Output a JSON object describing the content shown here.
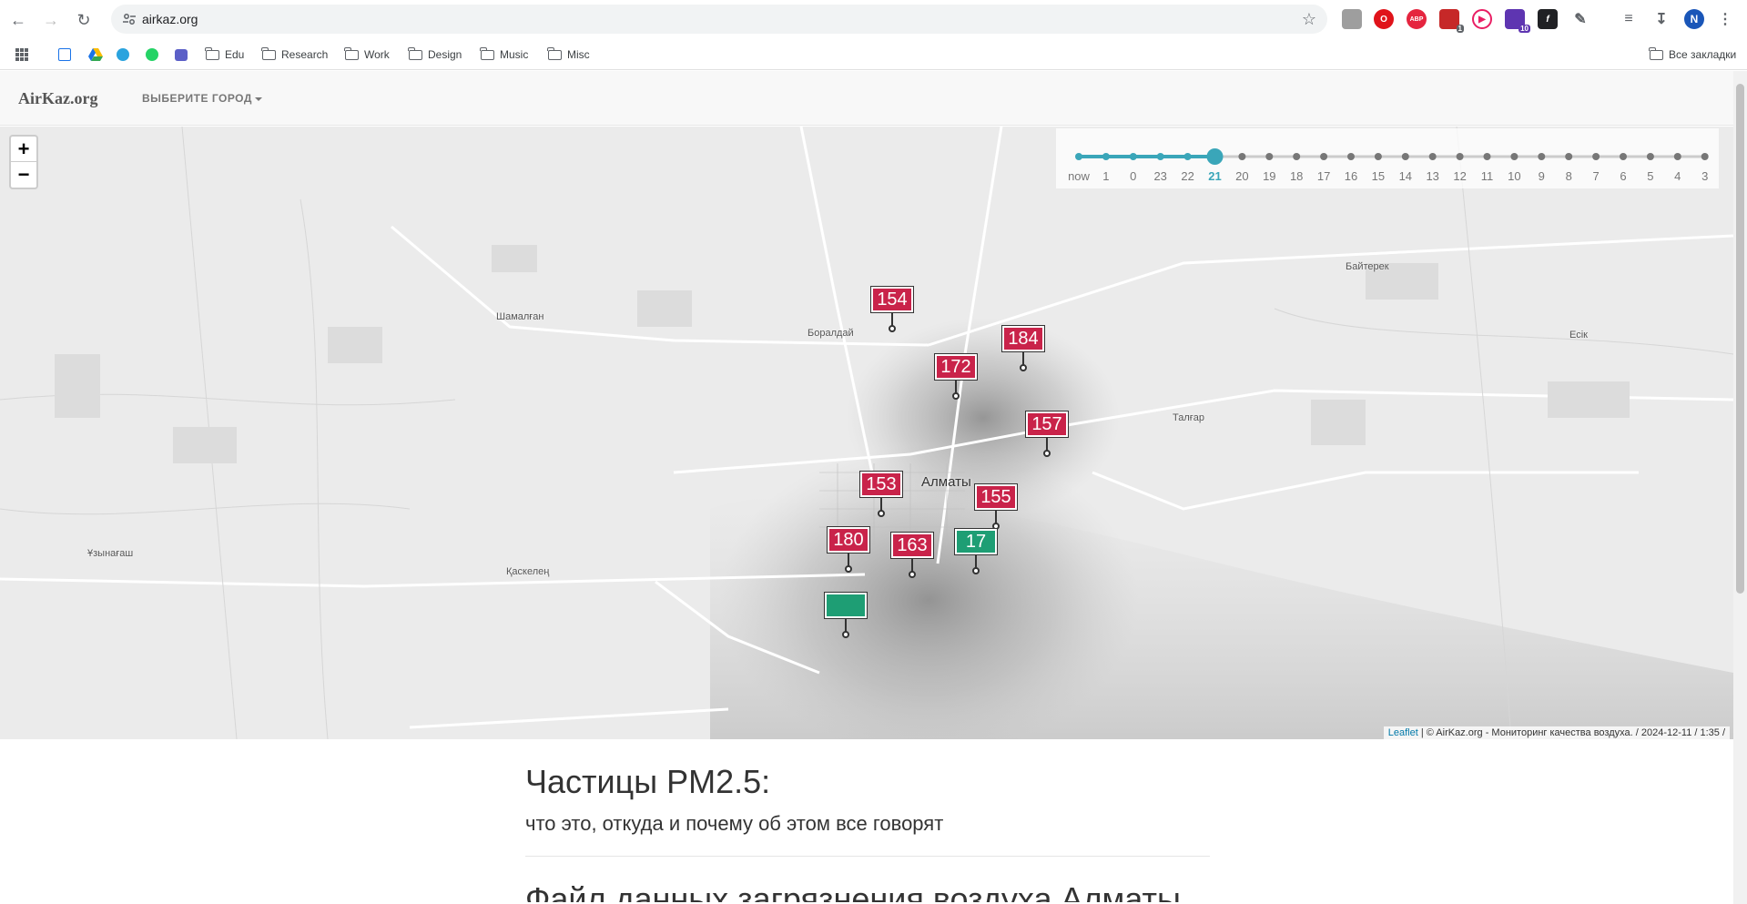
{
  "browser": {
    "url": "airkaz.org",
    "all_bookmarks": "Все закладки",
    "profile_initial": "N",
    "ext_badges": {
      "first": "1",
      "second": "10"
    }
  },
  "bookmarks": [
    {
      "label": "Edu"
    },
    {
      "label": "Research"
    },
    {
      "label": "Work"
    },
    {
      "label": "Design"
    },
    {
      "label": "Music"
    },
    {
      "label": "Misc"
    }
  ],
  "site": {
    "brand": "AirKaz.org",
    "city_menu": "ВЫБЕРИТЕ ГОРОД"
  },
  "timeline": {
    "labels": [
      "now",
      "1",
      "0",
      "23",
      "22",
      "21",
      "20",
      "19",
      "18",
      "17",
      "16",
      "15",
      "14",
      "13",
      "12",
      "11",
      "10",
      "9",
      "8",
      "7",
      "6",
      "5",
      "4",
      "3"
    ],
    "selected_index": 5
  },
  "map": {
    "zoom_in": "+",
    "zoom_out": "−",
    "city_label": "Алматы",
    "markers": [
      {
        "value": "154",
        "level": "high"
      },
      {
        "value": "184",
        "level": "high"
      },
      {
        "value": "172",
        "level": "high"
      },
      {
        "value": "157",
        "level": "high"
      },
      {
        "value": "153",
        "level": "high"
      },
      {
        "value": "155",
        "level": "high"
      },
      {
        "value": "180",
        "level": "high"
      },
      {
        "value": "163",
        "level": "high"
      },
      {
        "value": "17",
        "level": "good"
      },
      {
        "value": "",
        "level": "good"
      }
    ],
    "places": [
      {
        "label": "Боралдай"
      },
      {
        "label": "Шамалған"
      },
      {
        "label": "Ұзынағаш"
      },
      {
        "label": "Қаскелең"
      },
      {
        "label": "Талғар"
      },
      {
        "label": "Есік"
      },
      {
        "label": "Байтерек"
      }
    ],
    "attribution_link": "Leaflet",
    "attribution_text": " | © AirKaz.org - Мониторинг качества воздуха. / 2024-12-11 / 1:35 /",
    "colors": {
      "high": "#c9234a",
      "good": "#1e9e74"
    }
  },
  "article": {
    "title": "Частицы PM2.5:",
    "subtitle": "что это, откуда и почему об этом все говорят",
    "next_heading": "Файл данных загрязнения воздуха Алматы"
  }
}
